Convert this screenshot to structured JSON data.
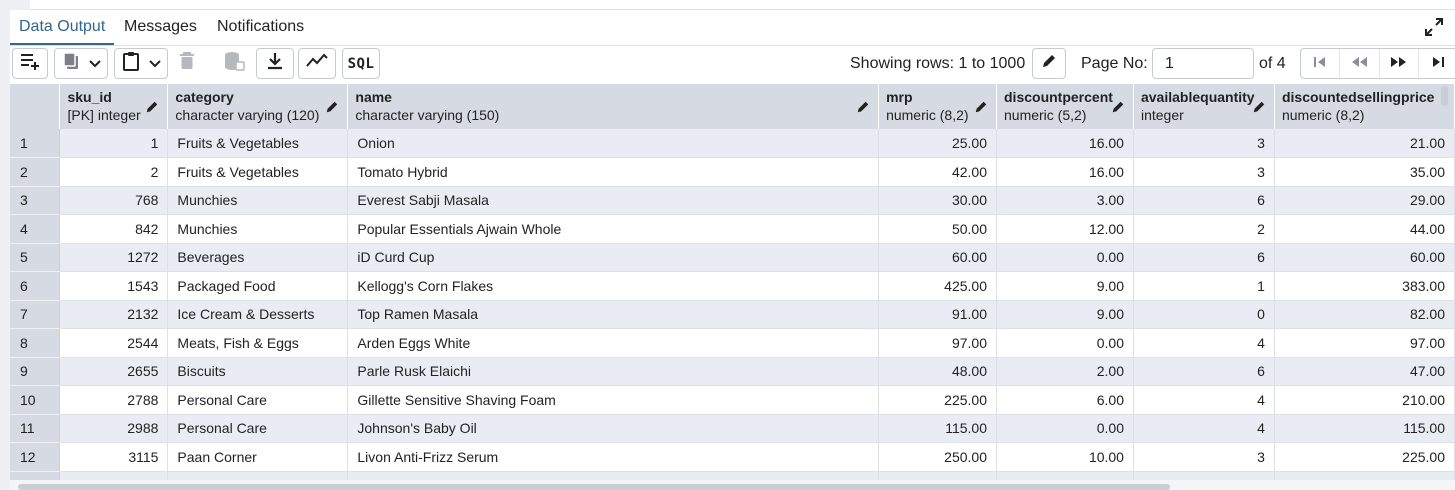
{
  "tabs": [
    {
      "label": "Data Output",
      "active": true
    },
    {
      "label": "Messages",
      "active": false
    },
    {
      "label": "Notifications",
      "active": false
    }
  ],
  "toolbar": {
    "sql_label": "SQL",
    "rows_info": "Showing rows: 1 to 1000",
    "page_label": "Page No:",
    "page_value": "1",
    "of_label": "of 4"
  },
  "columns": [
    {
      "name": "sku_id",
      "type": "[PK] integer"
    },
    {
      "name": "category",
      "type": "character varying (120)"
    },
    {
      "name": "name",
      "type": "character varying (150)"
    },
    {
      "name": "mrp",
      "type": "numeric (8,2)"
    },
    {
      "name": "discountpercent",
      "type": "numeric (5,2)"
    },
    {
      "name": "availablequantity",
      "type": "integer"
    },
    {
      "name": "discountedsellingprice",
      "type": "numeric (8,2)"
    }
  ],
  "rows": [
    {
      "n": "1",
      "sku_id": "1",
      "category": "Fruits & Vegetables",
      "name": "Onion",
      "mrp": "25.00",
      "discountpercent": "16.00",
      "availablequantity": "3",
      "dsp": "21.00"
    },
    {
      "n": "2",
      "sku_id": "2",
      "category": "Fruits & Vegetables",
      "name": "Tomato Hybrid",
      "mrp": "42.00",
      "discountpercent": "16.00",
      "availablequantity": "3",
      "dsp": "35.00"
    },
    {
      "n": "3",
      "sku_id": "768",
      "category": "Munchies",
      "name": "Everest Sabji Masala",
      "mrp": "30.00",
      "discountpercent": "3.00",
      "availablequantity": "6",
      "dsp": "29.00"
    },
    {
      "n": "4",
      "sku_id": "842",
      "category": "Munchies",
      "name": "Popular Essentials Ajwain Whole",
      "mrp": "50.00",
      "discountpercent": "12.00",
      "availablequantity": "2",
      "dsp": "44.00"
    },
    {
      "n": "5",
      "sku_id": "1272",
      "category": "Beverages",
      "name": "iD Curd Cup",
      "mrp": "60.00",
      "discountpercent": "0.00",
      "availablequantity": "6",
      "dsp": "60.00"
    },
    {
      "n": "6",
      "sku_id": "1543",
      "category": "Packaged Food",
      "name": "Kellogg's Corn Flakes",
      "mrp": "425.00",
      "discountpercent": "9.00",
      "availablequantity": "1",
      "dsp": "383.00"
    },
    {
      "n": "7",
      "sku_id": "2132",
      "category": "Ice Cream & Desserts",
      "name": "Top Ramen Masala",
      "mrp": "91.00",
      "discountpercent": "9.00",
      "availablequantity": "0",
      "dsp": "82.00"
    },
    {
      "n": "8",
      "sku_id": "2544",
      "category": "Meats, Fish & Eggs",
      "name": "Arden Eggs White",
      "mrp": "97.00",
      "discountpercent": "0.00",
      "availablequantity": "4",
      "dsp": "97.00"
    },
    {
      "n": "9",
      "sku_id": "2655",
      "category": "Biscuits",
      "name": "Parle Rusk Elaichi",
      "mrp": "48.00",
      "discountpercent": "2.00",
      "availablequantity": "6",
      "dsp": "47.00"
    },
    {
      "n": "10",
      "sku_id": "2788",
      "category": "Personal Care",
      "name": "Gillette Sensitive Shaving Foam",
      "mrp": "225.00",
      "discountpercent": "6.00",
      "availablequantity": "4",
      "dsp": "210.00"
    },
    {
      "n": "11",
      "sku_id": "2988",
      "category": "Personal Care",
      "name": "Johnson's Baby Oil",
      "mrp": "115.00",
      "discountpercent": "0.00",
      "availablequantity": "4",
      "dsp": "115.00"
    },
    {
      "n": "12",
      "sku_id": "3115",
      "category": "Paan Corner",
      "name": "Livon Anti-Frizz Serum",
      "mrp": "250.00",
      "discountpercent": "10.00",
      "availablequantity": "3",
      "dsp": "225.00"
    }
  ]
}
